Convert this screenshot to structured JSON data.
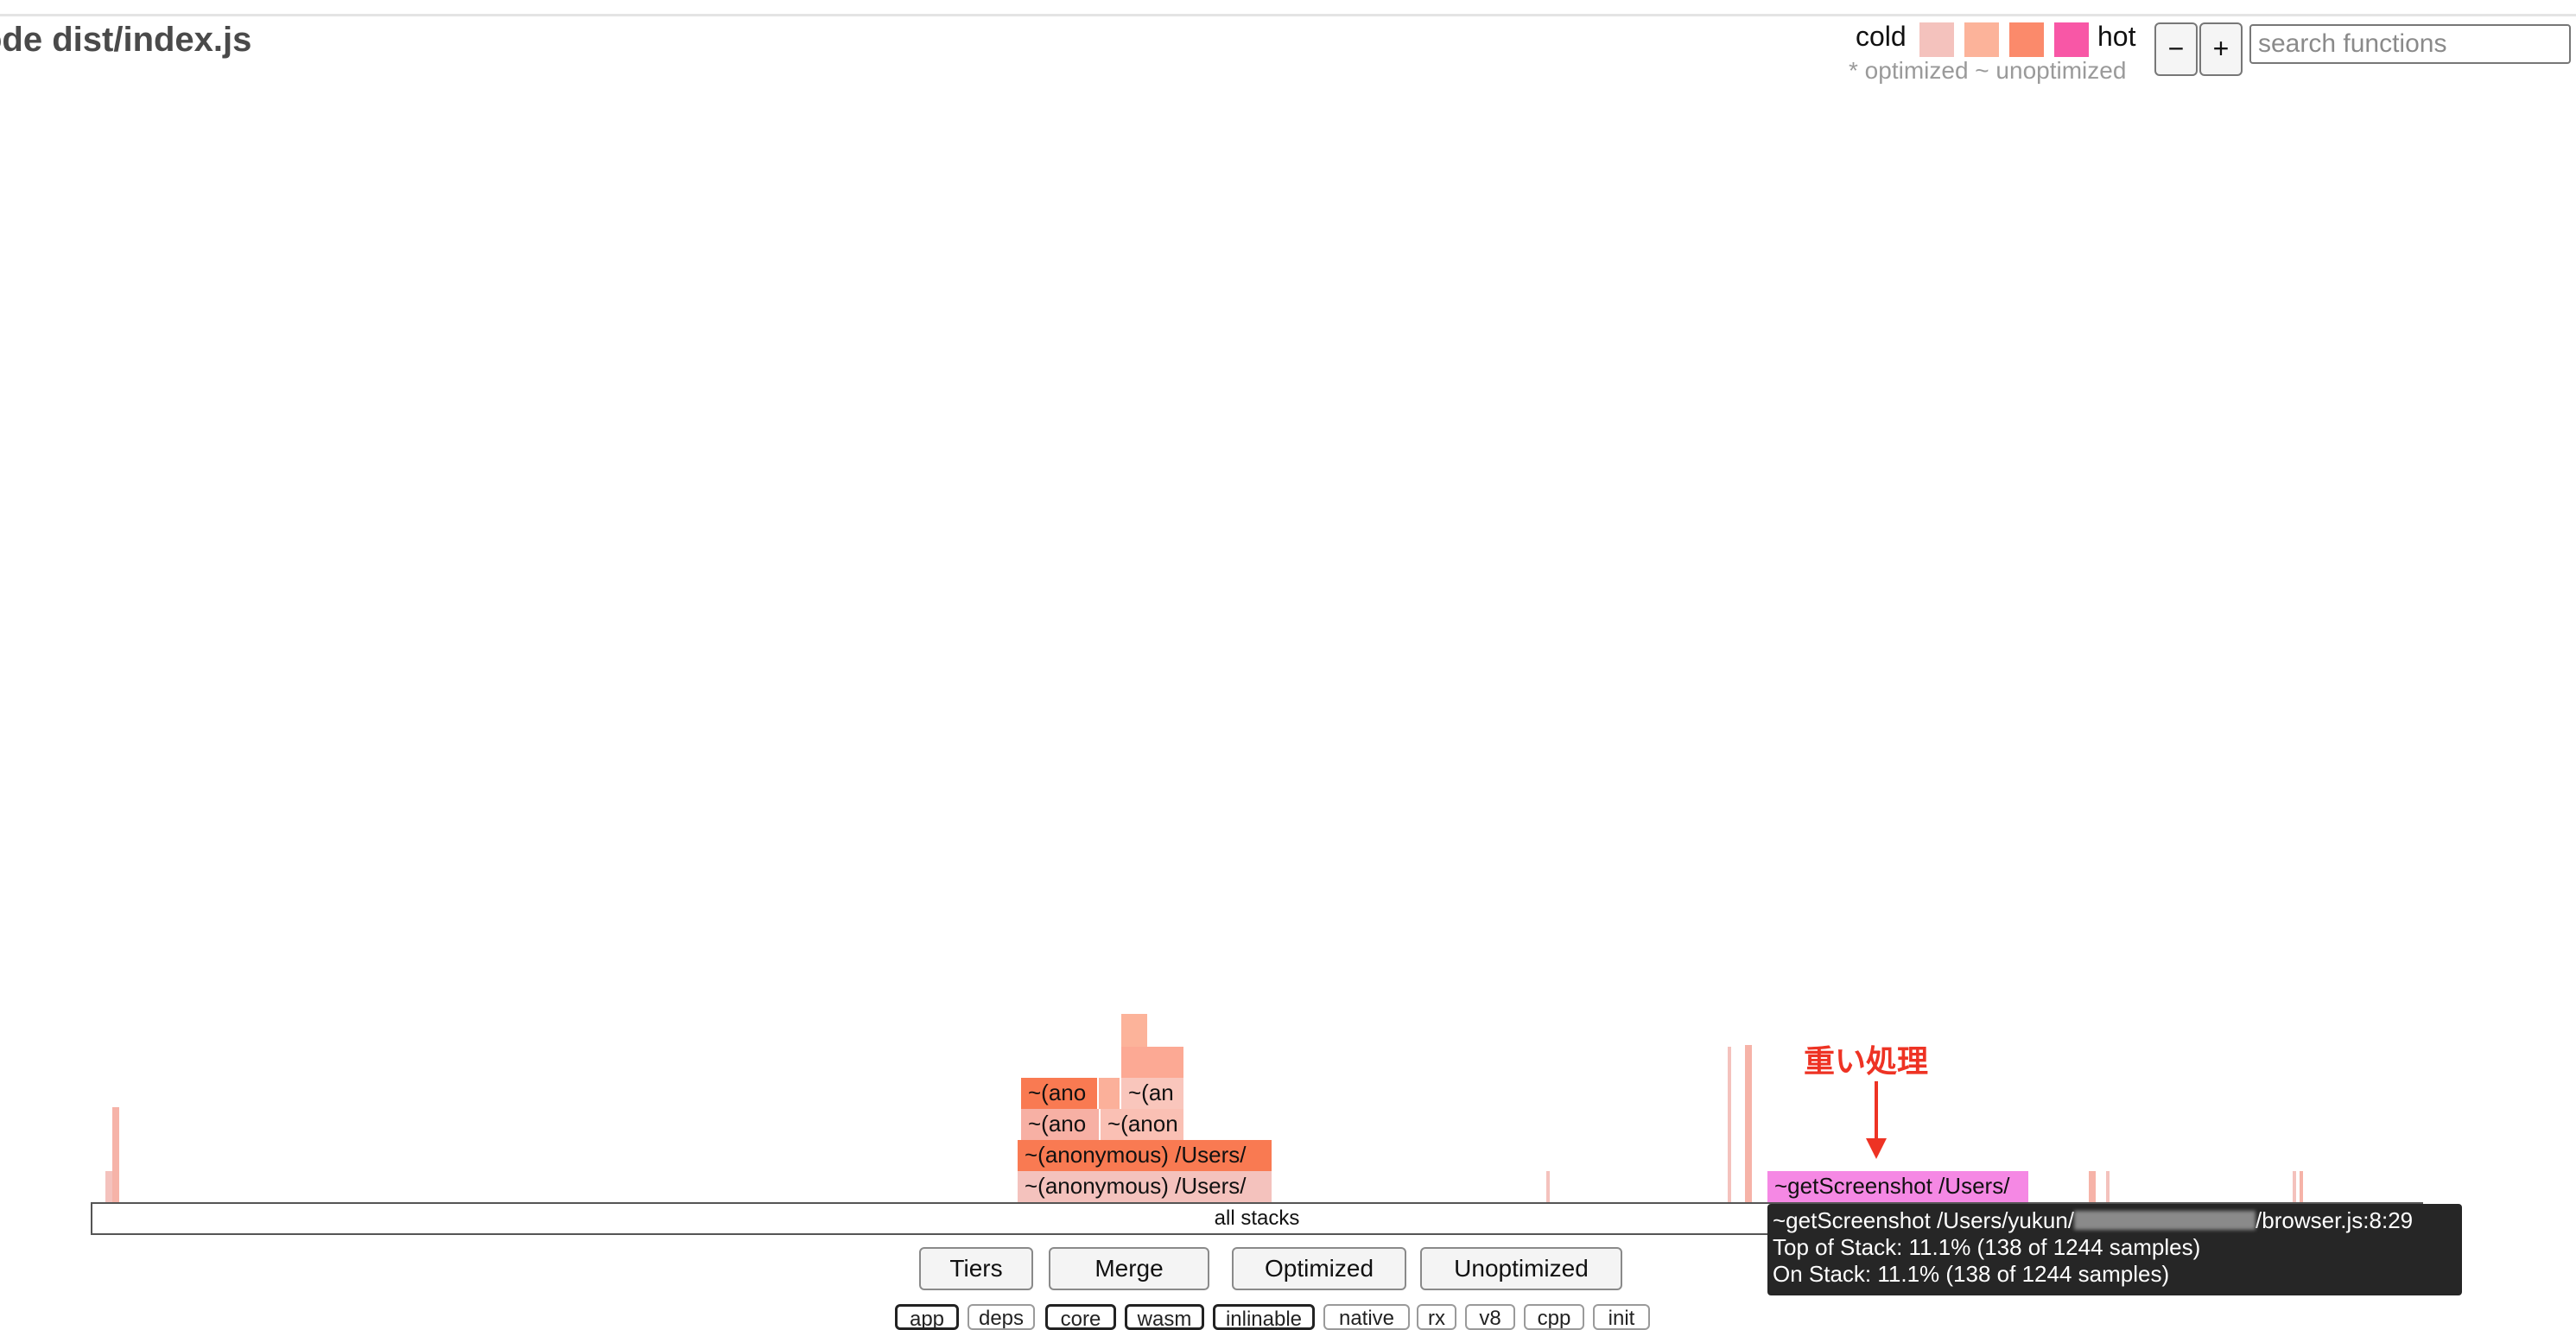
{
  "header": {
    "title": "ode dist/index.js"
  },
  "legend": {
    "cold_label": "cold",
    "hot_label": "hot",
    "swatch_colors": [
      "#f4c2bd",
      "#fcb39a",
      "#fb8a6b",
      "#f857a6"
    ],
    "note": "* optimized ~ unoptimized"
  },
  "zoom": {
    "out_label": "−",
    "in_label": "+"
  },
  "search": {
    "placeholder": "search functions"
  },
  "flamegraph": {
    "frames": {
      "anon_1": "~(anonymous) /Users/",
      "anon_2": "~(anonymous) /Users/",
      "anon_3a": "~(ano",
      "anon_3b": "~(anon",
      "anon_4a": "~(ano",
      "anon_4b": "~(an",
      "getscreenshot": "~getScreenshot /Users/"
    },
    "root_label": "all stacks",
    "colors": {
      "cold": "#f4c2bd",
      "warm": "#fcb39a",
      "hot": "#f97a52",
      "hottest": "#f588e4"
    }
  },
  "annotation": {
    "text": "重い処理",
    "color": "#ee3324"
  },
  "tooltip": {
    "line1_prefix": "~getScreenshot /Users/yukun/",
    "line1_suffix": "/browser.js:8:29",
    "line2": "Top of Stack: 11.1% (138 of 1244 samples)",
    "line3": "On Stack: 11.1% (138 of 1244 samples)",
    "top_of_stack_percent": 11.1,
    "on_stack_percent": 11.1,
    "samples": 138,
    "total_samples": 1244
  },
  "views": {
    "tiers": "Tiers",
    "merge": "Merge",
    "optimized": "Optimized",
    "unoptimized": "Unoptimized"
  },
  "filters": {
    "app": "app",
    "deps": "deps",
    "core": "core",
    "wasm": "wasm",
    "inlinable": "inlinable",
    "native": "native",
    "rx": "rx",
    "v8": "v8",
    "cpp": "cpp",
    "init": "init"
  }
}
